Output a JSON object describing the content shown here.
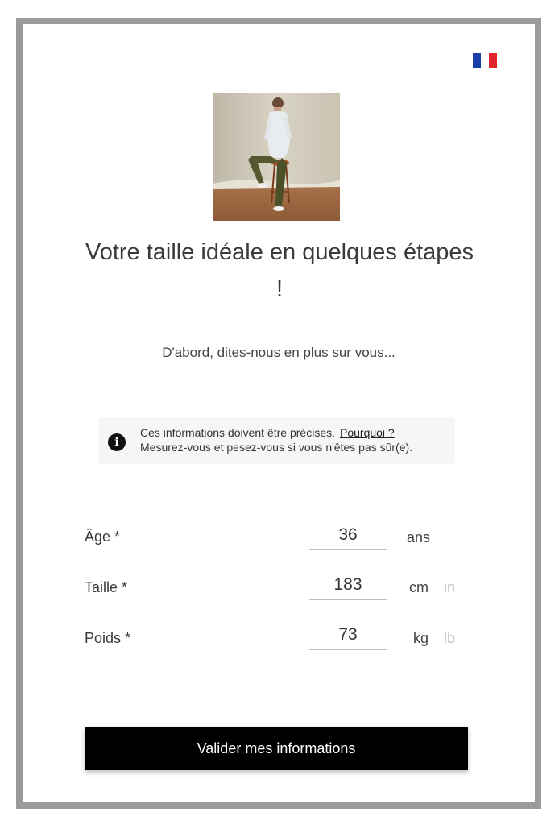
{
  "colors": {
    "frame_border": "#9a9a9a",
    "button_bg": "#000000",
    "button_text": "#ffffff",
    "info_bg": "#f5f7f7",
    "flag_blue": "#1a3ea8",
    "flag_white": "#ffffff",
    "flag_red": "#e0262d"
  },
  "language_flag": "french-flag-icon",
  "header": {
    "title": "Votre taille idéale en quelques étapes !",
    "subtitle": "D'abord, dites-nous en plus sur vous..."
  },
  "info": {
    "icon": "info-icon",
    "line1": "Ces informations doivent être précises.",
    "link": "Pourquoi ?",
    "line2": "Mesurez-vous et pesez-vous si vous n'êtes pas sûr(e)."
  },
  "fields": {
    "age": {
      "label": "Âge *",
      "value": "36",
      "unit": "ans"
    },
    "height": {
      "label": "Taille *",
      "value": "183",
      "unit": "cm",
      "alt_unit": "in"
    },
    "weight": {
      "label": "Poids *",
      "value": "73",
      "unit": "kg",
      "alt_unit": "lb"
    }
  },
  "submit_label": "Valider mes informations"
}
